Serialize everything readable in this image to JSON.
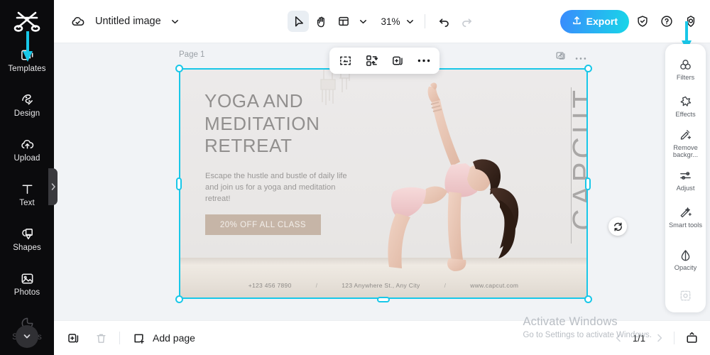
{
  "app": {
    "sidebar": {
      "logo_name": "capcut-logo",
      "items": [
        {
          "label": "Templates",
          "icon": "templates-icon"
        },
        {
          "label": "Design",
          "icon": "design-icon"
        },
        {
          "label": "Upload",
          "icon": "upload-cloud-icon"
        },
        {
          "label": "Text",
          "icon": "text-icon"
        },
        {
          "label": "Shapes",
          "icon": "shapes-icon"
        },
        {
          "label": "Photos",
          "icon": "photos-icon"
        },
        {
          "label": "Stickers",
          "icon": "stickers-icon"
        }
      ]
    },
    "topbar": {
      "cloud_icon": "cloud-saved-icon",
      "document_title": "Untitled image",
      "title_chevron": "chevron-down-icon",
      "tools": [
        {
          "name": "select-tool",
          "icon": "cursor-arrow-icon",
          "active": true
        },
        {
          "name": "hand-tool",
          "icon": "hand-icon",
          "active": false
        },
        {
          "name": "layout-tool",
          "icon": "layout-icon",
          "active": false
        }
      ],
      "zoom_value": "31%",
      "undo_icon": "undo-icon",
      "redo_icon": "redo-icon",
      "export_label": "Export",
      "export_icon": "upload-share-icon",
      "shield_icon": "shield-check-icon",
      "help_icon": "question-circle-icon",
      "settings_icon": "gear-icon",
      "accent_color": "#18c7e8",
      "export_gradient_from": "#3a8bfd",
      "export_gradient_to": "#17d6e8"
    },
    "canvas": {
      "page_label": "Page 1",
      "page_tools": [
        {
          "name": "page-layers-icon",
          "icon": "image-stack-icon"
        },
        {
          "name": "page-more-icon",
          "icon": "more-horizontal-icon"
        }
      ],
      "float_toolbar": [
        {
          "name": "crop-cutout-button",
          "icon": "crop-dashed-icon"
        },
        {
          "name": "replace-media-button",
          "icon": "swap-arrows-icon"
        },
        {
          "name": "duplicate-button",
          "icon": "duplicate-plus-icon"
        },
        {
          "name": "more-options-button",
          "icon": "more-horizontal-icon"
        }
      ],
      "rotate_handle_icon": "rotate-icon",
      "selection_color": "#18c7e8"
    },
    "poster": {
      "headline": "YOGA AND MEDITATION RETREAT",
      "body": "Escape the hustle and bustle of daily life and join us for a yoga and meditation retreat!",
      "cta_label": "20% OFF ALL CLASS",
      "cta_color": "#c6b5a7",
      "vertical_text": "CAPCUT",
      "footer": {
        "phone": "+123 456 7890",
        "address": "123 Anywhere St., Any City",
        "website": "www.capcut.com",
        "separator": "/"
      }
    },
    "right_panel": {
      "items": [
        {
          "label": "Filters",
          "icon": "filters-circles-icon",
          "dim": false
        },
        {
          "label": "Effects",
          "icon": "effects-star-icon",
          "dim": false
        },
        {
          "label": "Remove backgr...",
          "icon": "remove-background-icon",
          "dim": false
        },
        {
          "label": "Adjust",
          "icon": "adjust-sliders-icon",
          "dim": false
        },
        {
          "label": "Smart tools",
          "icon": "smart-tools-wand-icon",
          "dim": false
        },
        {
          "label": "Opacity",
          "icon": "opacity-drop-icon",
          "dim": false
        },
        {
          "label": "",
          "icon": "crop-frame-icon",
          "dim": true
        }
      ]
    },
    "bottombar": {
      "duplicate_page_icon": "duplicate-page-icon",
      "delete_page_icon": "trash-icon",
      "add_page_label": "Add page",
      "add_page_icon": "add-page-icon",
      "prev_icon": "chevron-left-icon",
      "page_count": "1/1",
      "next_icon": "chevron-right-icon",
      "present_icon": "present-screen-icon"
    },
    "watermark": {
      "line1": "Activate Windows",
      "line2": "Go to Settings to activate Windows."
    }
  }
}
